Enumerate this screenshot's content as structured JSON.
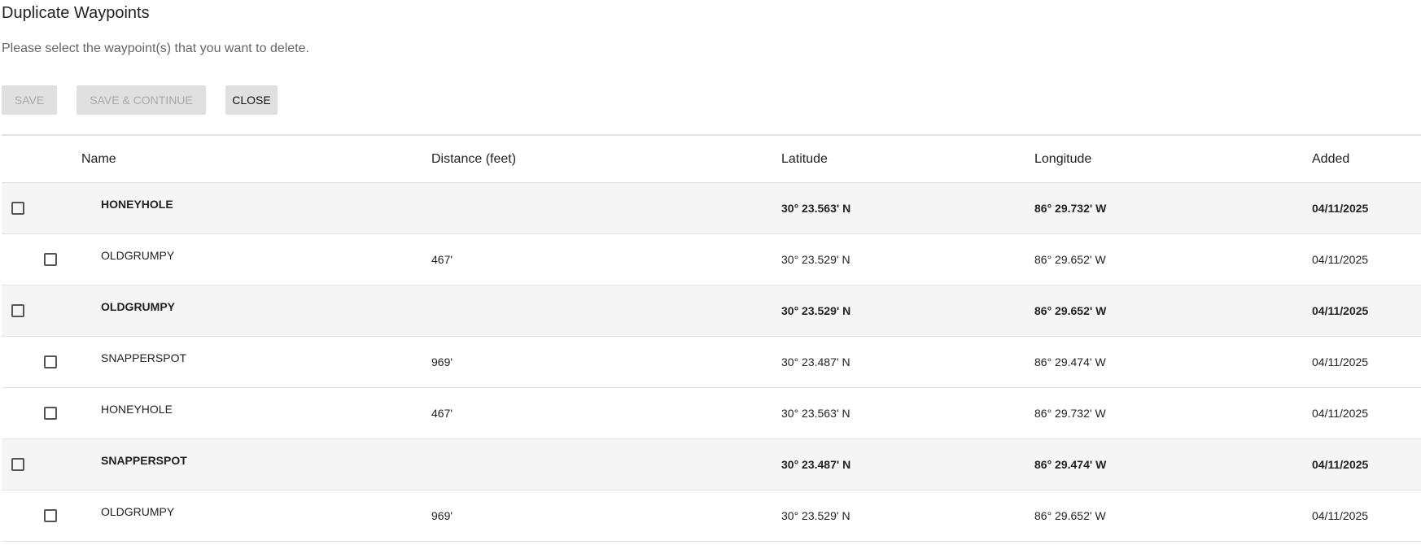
{
  "dialog": {
    "title": "Duplicate Waypoints",
    "subtitle": "Please select the waypoint(s) that you want to delete."
  },
  "buttons": {
    "save": "SAVE",
    "save_continue": "SAVE & CONTINUE",
    "close": "CLOSE"
  },
  "table": {
    "headers": {
      "name": "Name",
      "distance": "Distance (feet)",
      "latitude": "Latitude",
      "longitude": "Longitude",
      "added": "Added"
    },
    "rows": [
      {
        "type": "parent",
        "name": "HONEYHOLE",
        "distance": "",
        "latitude": "30° 23.563' N",
        "longitude": "86° 29.732' W",
        "added": "04/11/2025",
        "checked": false
      },
      {
        "type": "child",
        "name": "OLDGRUMPY",
        "distance": "467'",
        "latitude": "30° 23.529' N",
        "longitude": "86° 29.652' W",
        "added": "04/11/2025",
        "checked": false
      },
      {
        "type": "parent",
        "name": "OLDGRUMPY",
        "distance": "",
        "latitude": "30° 23.529' N",
        "longitude": "86° 29.652' W",
        "added": "04/11/2025",
        "checked": false
      },
      {
        "type": "child",
        "name": "SNAPPERSPOT",
        "distance": "969'",
        "latitude": "30° 23.487' N",
        "longitude": "86° 29.474' W",
        "added": "04/11/2025",
        "checked": false
      },
      {
        "type": "child",
        "name": "HONEYHOLE",
        "distance": "467'",
        "latitude": "30° 23.563' N",
        "longitude": "86° 29.732' W",
        "added": "04/11/2025",
        "checked": false
      },
      {
        "type": "parent",
        "name": "SNAPPERSPOT",
        "distance": "",
        "latitude": "30° 23.487' N",
        "longitude": "86° 29.474' W",
        "added": "04/11/2025",
        "checked": false
      },
      {
        "type": "child",
        "name": "OLDGRUMPY",
        "distance": "969'",
        "latitude": "30° 23.529' N",
        "longitude": "86° 29.652' W",
        "added": "04/11/2025",
        "checked": false
      }
    ]
  }
}
